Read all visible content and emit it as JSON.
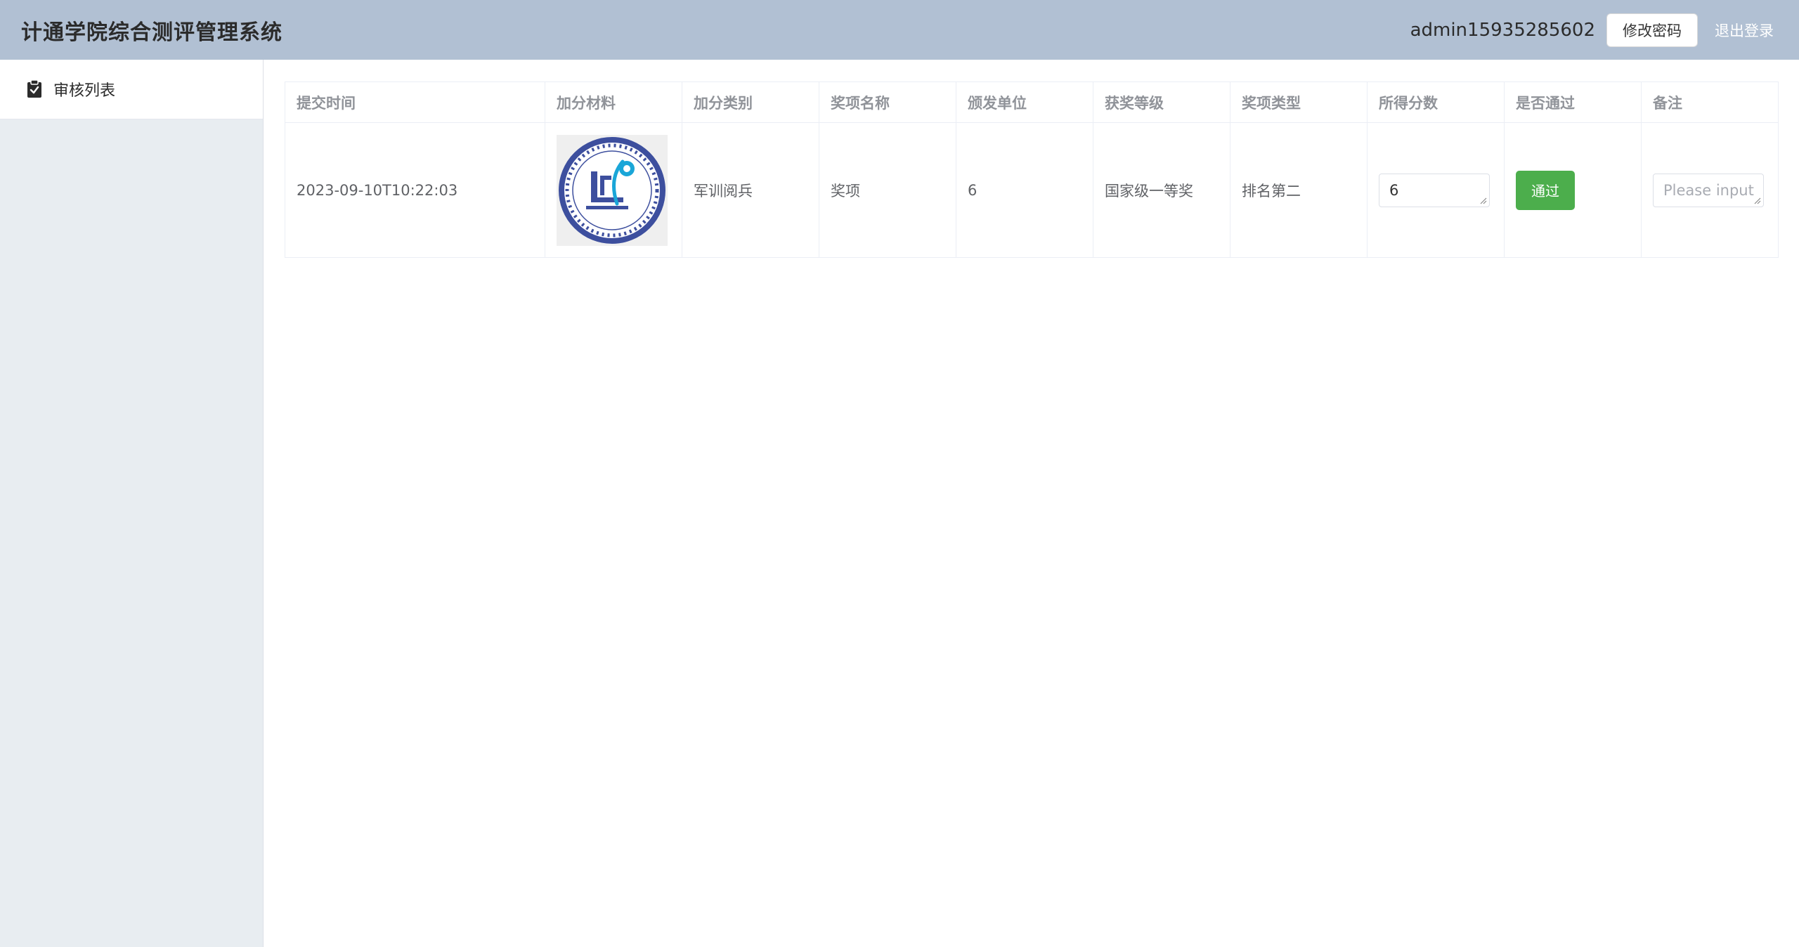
{
  "header": {
    "title": "计通学院综合测评管理系统",
    "username": "admin15935285602",
    "change_password": "修改密码",
    "logout": "退出登录"
  },
  "sidebar": {
    "items": [
      {
        "label": "审核列表",
        "icon": "clipboard-check-icon"
      }
    ]
  },
  "table": {
    "columns": [
      "提交时间",
      "加分材料",
      "加分类别",
      "奖项名称",
      "颁发单位",
      "获奖等级",
      "奖项类型",
      "所得分数",
      "是否通过",
      "备注"
    ],
    "rows": [
      {
        "submit_time": "2023-09-10T10:22:03",
        "material": "school-emblem-image",
        "category": "军训阅兵",
        "award_name": "奖项",
        "issuer": "6",
        "level": "国家级一等奖",
        "award_type": "排名第二",
        "score": "6",
        "pass_label": "通过",
        "remark_placeholder": "Please input"
      }
    ]
  },
  "colors": {
    "header_bg": "#b1c0d3",
    "sidebar_bg": "#e8edf1",
    "pass_button": "#4cae4c",
    "emblem_blue": "#3d4f9e",
    "emblem_cyan": "#1aa6d8"
  }
}
